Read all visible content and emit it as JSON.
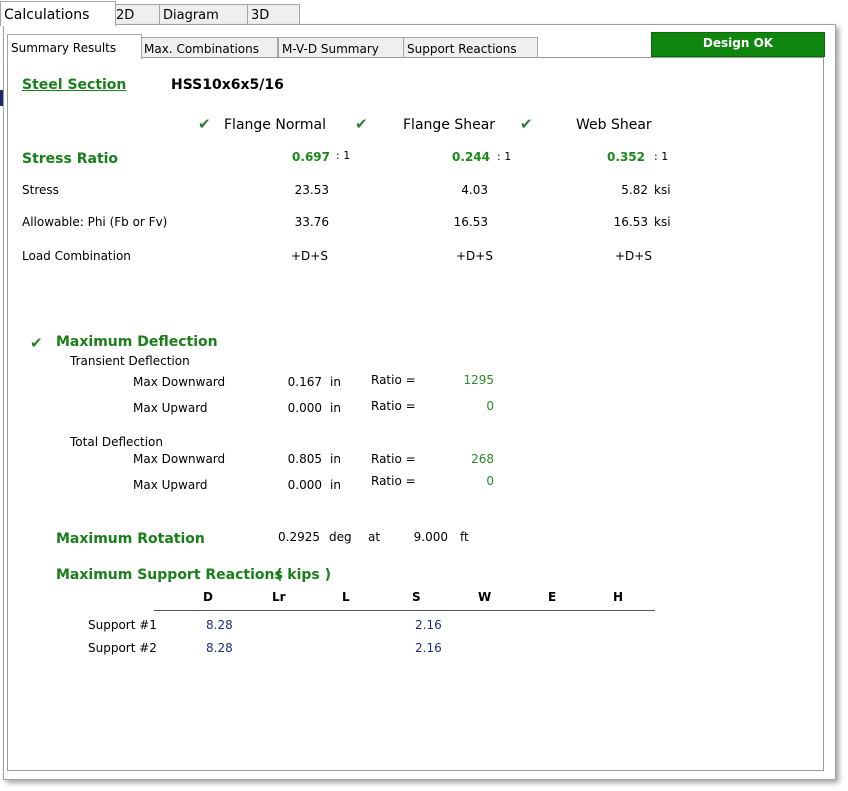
{
  "tabs_top": [
    {
      "label": "Calculations",
      "active": true
    },
    {
      "label": "2D",
      "active": false
    },
    {
      "label": "Diagram",
      "active": false
    },
    {
      "label": "3D",
      "active": false
    }
  ],
  "tabs_sub": [
    {
      "label": "Summary Results",
      "active": true
    },
    {
      "label": "Max. Combinations",
      "active": false
    },
    {
      "label": "M-V-D Summary",
      "active": false
    },
    {
      "label": "Support Reactions",
      "active": false
    }
  ],
  "design_status": "Design OK",
  "steel_section": {
    "label": "Steel Section",
    "value": "HSS10x6x5/16"
  },
  "checks": [
    "Flange Normal",
    "Flange Shear",
    "Web Shear"
  ],
  "check_icon": "check-icon",
  "stress_ratio": {
    "label": "Stress Ratio",
    "values": [
      "0.697",
      "0.244",
      "0.352"
    ],
    "suffixes": [
      ": 1",
      ": 1",
      ": 1"
    ]
  },
  "stress": {
    "label": "Stress",
    "values": [
      "23.53",
      "4.03",
      "5.82"
    ],
    "unit": "ksi"
  },
  "allowable": {
    "label": "Allowable: Phi (Fb or Fv)",
    "values": [
      "33.76",
      "16.53",
      "16.53"
    ],
    "unit": "ksi"
  },
  "load_combination": {
    "label": "Load Combination",
    "values": [
      "+D+S",
      "+D+S",
      "+D+S"
    ]
  },
  "deflection": {
    "title": "Maximum Deflection",
    "transient": {
      "label": "Transient Deflection",
      "rows": [
        {
          "label": "Max Downward",
          "value": "0.167",
          "unit": "in",
          "ratio_label": "Ratio =",
          "ratio": "1295"
        },
        {
          "label": "Max Upward",
          "value": "0.000",
          "unit": "in",
          "ratio_label": "Ratio =",
          "ratio": "0"
        }
      ]
    },
    "total": {
      "label": "Total Deflection",
      "rows": [
        {
          "label": "Max Downward",
          "value": "0.805",
          "unit": "in",
          "ratio_label": "Ratio =",
          "ratio": "268"
        },
        {
          "label": "Max Upward",
          "value": "0.000",
          "unit": "in",
          "ratio_label": "Ratio =",
          "ratio": "0"
        }
      ]
    }
  },
  "rotation": {
    "title": "Maximum Rotation",
    "value": "0.2925",
    "unit": "deg",
    "at": "at",
    "location": "9.000",
    "loc_unit": "ft"
  },
  "reactions": {
    "title": "Maximum Support Reactions",
    "units": "( kips )",
    "columns": [
      "D",
      "Lr",
      "L",
      "S",
      "W",
      "E",
      "H"
    ],
    "rows": [
      {
        "label": "Support #1",
        "values": [
          "8.28",
          "",
          "",
          "2.16",
          "",
          "",
          ""
        ]
      },
      {
        "label": "Support #2",
        "values": [
          "8.28",
          "",
          "",
          "2.16",
          "",
          "",
          ""
        ]
      }
    ]
  },
  "colors": {
    "accent_green": "#1a7f1a",
    "status_green": "#0f870f",
    "value_blue": "#1c2f86"
  }
}
